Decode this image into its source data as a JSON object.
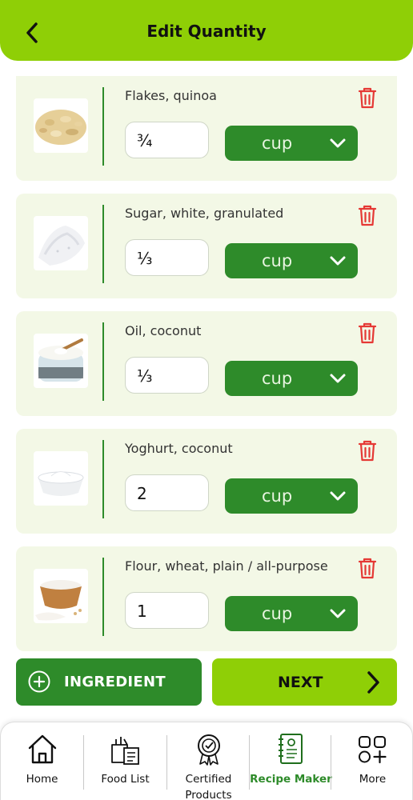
{
  "header": {
    "title": "Edit Quantity",
    "back_icon": "chevron-left-icon"
  },
  "ingredients": [
    {
      "name": "Flakes, quinoa",
      "quantity": "¾",
      "unit": "cup"
    },
    {
      "name": "Sugar, white, granulated",
      "quantity": "⅓",
      "unit": "cup"
    },
    {
      "name": "Oil, coconut",
      "quantity": "⅓",
      "unit": "cup"
    },
    {
      "name": "Yoghurt, coconut",
      "quantity": "2",
      "unit": "cup"
    },
    {
      "name": "Flour, wheat, plain / all-purpose",
      "quantity": "1",
      "unit": "cup"
    }
  ],
  "actions": {
    "add_ingredient_label": "INGREDIENT",
    "next_label": "NEXT"
  },
  "nav": {
    "items": [
      {
        "label": "Home",
        "icon": "home-icon"
      },
      {
        "label": "Food List",
        "icon": "food-list-icon"
      },
      {
        "label": "Certified Products",
        "icon": "certified-badge-icon"
      },
      {
        "label": "Recipe Maker",
        "icon": "recipe-book-icon",
        "active": true
      },
      {
        "label": "More",
        "icon": "more-grid-icon"
      }
    ]
  },
  "colors": {
    "primary_green": "#2e8b2a",
    "lime": "#8fcf06",
    "card_bg": "#f3f8e6",
    "delete_red": "#e53935"
  }
}
